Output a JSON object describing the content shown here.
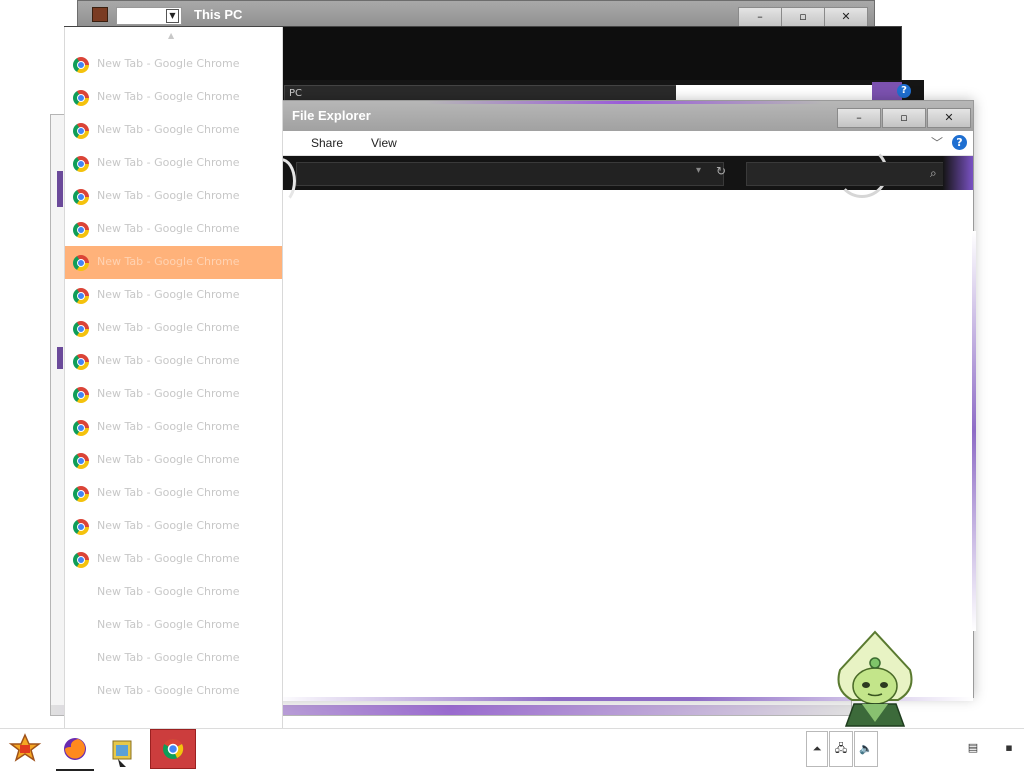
{
  "back_window": {
    "title": "This PC",
    "min": "–",
    "max": "▫",
    "close": "✕"
  },
  "back_window2": {
    "address_fragment": "PC"
  },
  "main_window": {
    "title": "File Explorer",
    "ribbon_tabs": [
      "Share",
      "View"
    ],
    "min": "–",
    "max": "▫",
    "close": "✕",
    "help": "?"
  },
  "jumplist": {
    "items": [
      {
        "label": "New Tab - Google Chrome",
        "icon": "chrome-icon"
      },
      {
        "label": "New Tab - Google Chrome",
        "icon": "chrome-icon"
      },
      {
        "label": "New Tab - Google Chrome",
        "icon": "chrome-icon"
      },
      {
        "label": "New Tab - Google Chrome",
        "icon": "chrome-icon"
      },
      {
        "label": "New Tab - Google Chrome",
        "icon": "chrome-icon"
      },
      {
        "label": "New Tab - Google Chrome",
        "icon": "chrome-icon"
      },
      {
        "label": "New Tab - Google Chrome",
        "icon": "chrome-icon",
        "selected": true
      },
      {
        "label": "New Tab - Google Chrome",
        "icon": "chrome-icon"
      },
      {
        "label": "New Tab - Google Chrome",
        "icon": "chrome-icon"
      },
      {
        "label": "New Tab - Google Chrome",
        "icon": "chrome-icon"
      },
      {
        "label": "New Tab - Google Chrome",
        "icon": "chrome-icon"
      },
      {
        "label": "New Tab - Google Chrome",
        "icon": "chrome-icon"
      },
      {
        "label": "New Tab - Google Chrome",
        "icon": "chrome-icon"
      },
      {
        "label": "New Tab - Google Chrome",
        "icon": "chrome-icon"
      },
      {
        "label": "New Tab - Google Chrome",
        "icon": "chrome-icon"
      },
      {
        "label": "New Tab - Google Chrome",
        "icon": "chrome-icon"
      },
      {
        "label": "New Tab - Google Chrome",
        "icon": null
      },
      {
        "label": "New Tab - Google Chrome",
        "icon": null
      },
      {
        "label": "New Tab - Google Chrome",
        "icon": null
      },
      {
        "label": "New Tab - Google Chrome",
        "icon": null
      }
    ],
    "selected_color": "#ffb27a"
  },
  "taskbar": {
    "apps": [
      {
        "name": "start-button",
        "icon": "start-icon"
      },
      {
        "name": "firefox",
        "icon": "firefox-icon"
      },
      {
        "name": "file-explorer",
        "icon": "folder-icon"
      },
      {
        "name": "chrome",
        "icon": "chrome-icon",
        "active": true
      }
    ],
    "tray": [
      "show-hidden-icons",
      "network-icon",
      "volume-icon",
      "clock",
      "action-center-icon",
      "show-desktop"
    ],
    "active_color": "#cc3d3d"
  },
  "accent_color": "#8e6cc6"
}
